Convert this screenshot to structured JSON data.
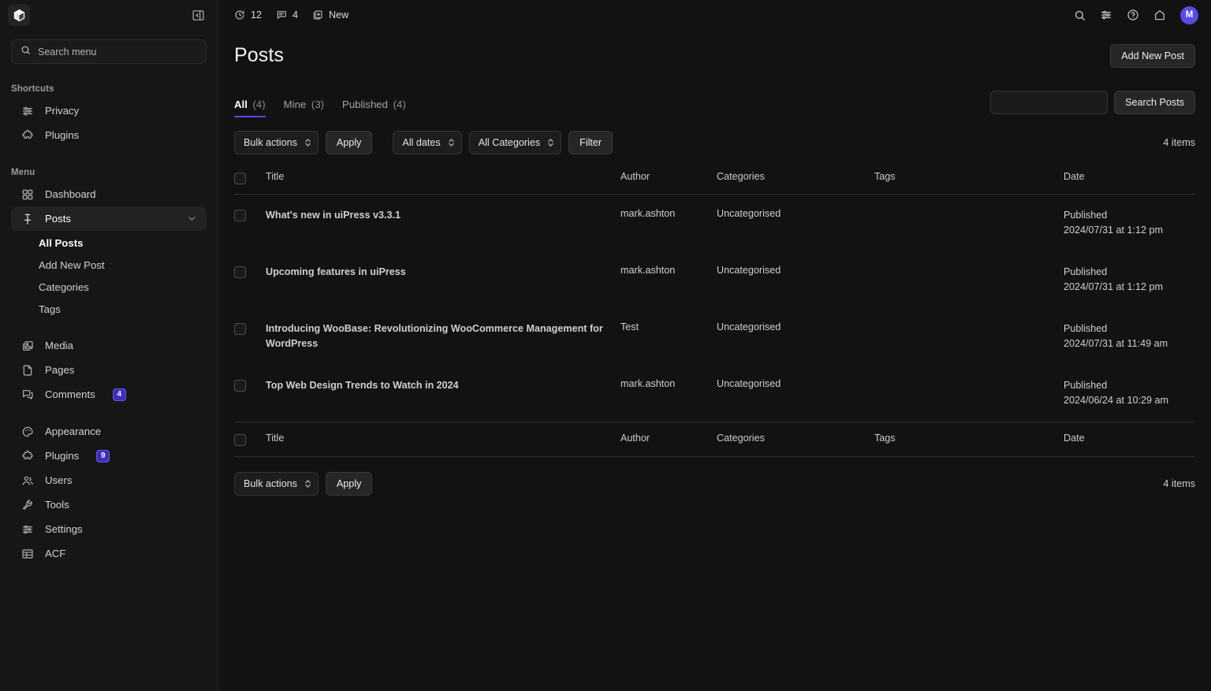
{
  "sidebar": {
    "logo_icon": "uipress-cube-logo",
    "collapse_icon": "panel-collapse-icon",
    "search": {
      "placeholder": "Search menu",
      "value": "",
      "icon": "search-icon"
    },
    "shortcuts_label": "Shortcuts",
    "shortcuts": [
      {
        "label": "Privacy",
        "icon": "sliders-icon"
      },
      {
        "label": "Plugins",
        "icon": "puzzle-icon"
      }
    ],
    "menu_label": "Menu",
    "menu": [
      {
        "label": "Dashboard",
        "icon": "grid-icon",
        "active": false,
        "badge": ""
      },
      {
        "label": "Posts",
        "icon": "pin-icon",
        "active": true,
        "badge": "",
        "chevron": "chevron-down-icon"
      },
      {
        "label": "Media",
        "icon": "media-icon",
        "active": false,
        "badge": ""
      },
      {
        "label": "Pages",
        "icon": "page-icon",
        "active": false,
        "badge": ""
      },
      {
        "label": "Comments",
        "icon": "comments-icon",
        "active": false,
        "badge": "4"
      },
      {
        "label": "Appearance",
        "icon": "palette-icon",
        "active": false,
        "badge": ""
      },
      {
        "label": "Plugins",
        "icon": "puzzle-icon",
        "active": false,
        "badge": "9"
      },
      {
        "label": "Users",
        "icon": "users-icon",
        "active": false,
        "badge": ""
      },
      {
        "label": "Tools",
        "icon": "wrench-icon",
        "active": false,
        "badge": ""
      },
      {
        "label": "Settings",
        "icon": "sliders-icon",
        "active": false,
        "badge": ""
      },
      {
        "label": "ACF",
        "icon": "table-icon",
        "active": false,
        "badge": ""
      }
    ],
    "posts_submenu": [
      {
        "label": "All Posts",
        "current": true
      },
      {
        "label": "Add New Post",
        "current": false
      },
      {
        "label": "Categories",
        "current": false
      },
      {
        "label": "Tags",
        "current": false
      }
    ]
  },
  "topbar": {
    "updates": {
      "icon": "updates-clock-icon",
      "count": "12"
    },
    "comments": {
      "icon": "comment-bubble-icon",
      "count": "4"
    },
    "new": {
      "icon": "new-plus-icon",
      "label": "New"
    },
    "right_icons": [
      {
        "name": "search-icon"
      },
      {
        "name": "sliders-icon"
      },
      {
        "name": "help-circle-icon"
      },
      {
        "name": "home-icon"
      }
    ],
    "avatar_initial": "M"
  },
  "page": {
    "title": "Posts",
    "add_new_label": "Add New Post",
    "tabs": [
      {
        "label": "All",
        "count": "(4)",
        "active": true
      },
      {
        "label": "Mine",
        "count": "(3)",
        "active": false
      },
      {
        "label": "Published",
        "count": "(4)",
        "active": false
      }
    ],
    "search_posts": {
      "value": "",
      "placeholder": "",
      "button_label": "Search Posts"
    }
  },
  "toolbar": {
    "bulk_actions_label": "Bulk actions",
    "apply_label": "Apply",
    "all_dates_label": "All dates",
    "all_categories_label": "All Categories",
    "filter_label": "Filter",
    "items_count": "4 items"
  },
  "table": {
    "columns": [
      "Title",
      "Author",
      "Categories",
      "Tags",
      "Date"
    ],
    "rows": [
      {
        "title": "What's new in uiPress v3.3.1",
        "author": "mark.ashton",
        "categories": "Uncategorised",
        "tags": "",
        "date_status": "Published",
        "date_value": "2024/07/31 at 1:12 pm"
      },
      {
        "title": "Upcoming features in uiPress",
        "author": "mark.ashton",
        "categories": "Uncategorised",
        "tags": "",
        "date_status": "Published",
        "date_value": "2024/07/31 at 1:12 pm"
      },
      {
        "title": "Introducing WooBase: Revolutionizing WooCommerce Management for WordPress",
        "author": "Test",
        "categories": "Uncategorised",
        "tags": "",
        "date_status": "Published",
        "date_value": "2024/07/31 at 11:49 am"
      },
      {
        "title": "Top Web Design Trends to Watch in 2024",
        "author": "mark.ashton",
        "categories": "Uncategorised",
        "tags": "",
        "date_status": "Published",
        "date_value": "2024/06/24 at 10:29 am"
      }
    ]
  },
  "bottom_toolbar": {
    "bulk_actions_label": "Bulk actions",
    "apply_label": "Apply",
    "items_count": "4 items"
  },
  "colors": {
    "accent": "#5b4ae6",
    "badge_bg": "#3d2fb8",
    "app_bg": "#121212",
    "sidebar_bg": "#161616"
  }
}
